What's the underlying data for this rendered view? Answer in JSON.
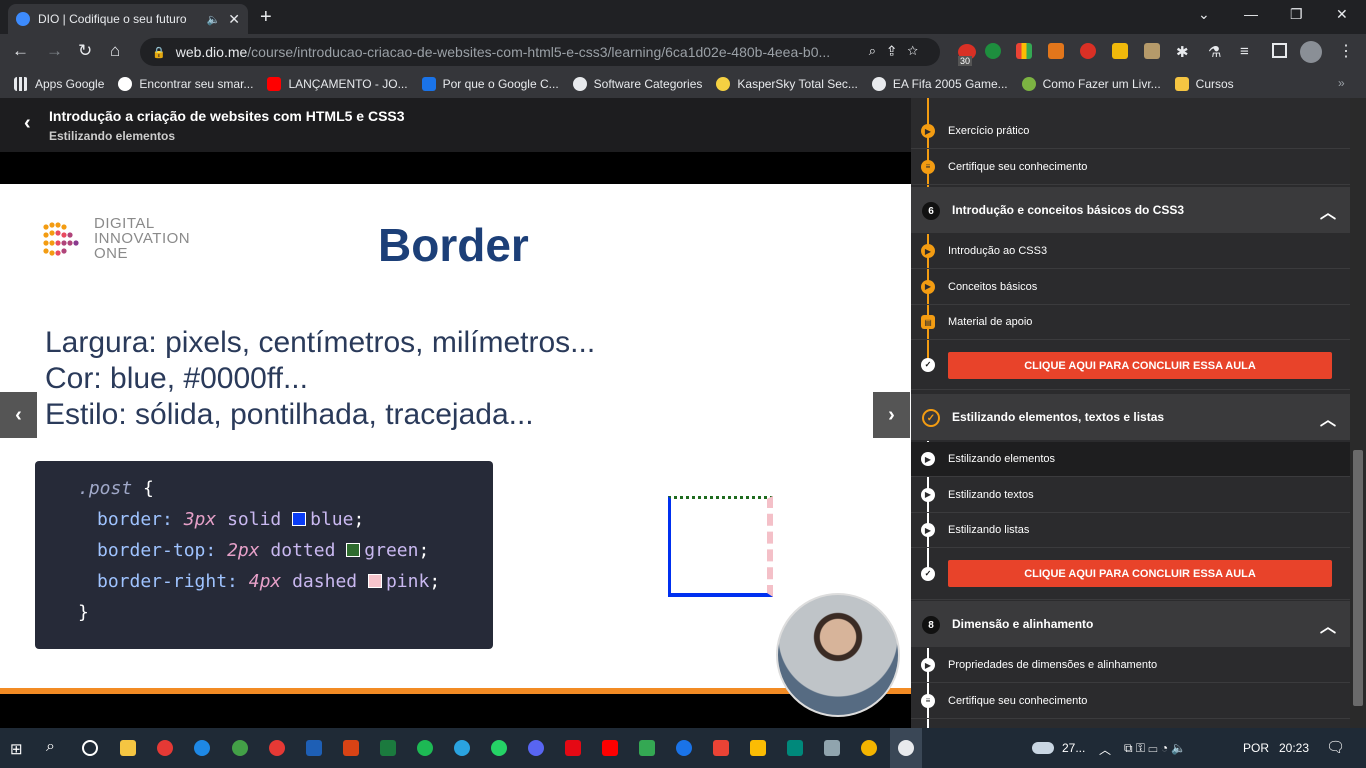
{
  "browser": {
    "tab_title": "DIO | Codifique o seu futuro",
    "url_host": "web.dio.me",
    "url_path": "/course/introducao-criacao-de-websites-com-html5-e-css3/learning/6ca1d02e-480b-4eea-b0...",
    "extension_badge": "30"
  },
  "bookmarks": [
    {
      "label": "Apps Google",
      "color": "#e8eaed"
    },
    {
      "label": "Encontrar seu smar...",
      "color": "#ffffff"
    },
    {
      "label": "LANÇAMENTO - JO...",
      "color": "#ff0000"
    },
    {
      "label": "Por que o Google C...",
      "color": "#1a73e8"
    },
    {
      "label": "Software Categories",
      "color": "#ffffff"
    },
    {
      "label": "KasperSky Total Sec...",
      "color": "#f5d142"
    },
    {
      "label": "EA Fifa 2005 Game...",
      "color": "#ffffff"
    },
    {
      "label": "Como Fazer um Livr...",
      "color": "#7cb342"
    },
    {
      "label": "Cursos",
      "color": "#f5c542"
    }
  ],
  "course": {
    "title": "Introdução a criação de websites com HTML5 e CSS3",
    "subtitle": "Estilizando elementos"
  },
  "slide": {
    "logo_line1": "DIGITAL",
    "logo_line2": "INNOVATION",
    "logo_line3": "ONE",
    "title": "Border",
    "line1": "Largura: pixels, centímetros, milímetros...",
    "line2": "Cor: blue, #0000ff...",
    "line3": "Estilo: sólida, pontilhada, tracejada...",
    "code": {
      "selector": ".post",
      "open": "{",
      "close": "}",
      "decl": [
        {
          "prop": "border",
          "value": "3px",
          "style": "solid",
          "color_name": "blue",
          "swatch": "#0a3cf5"
        },
        {
          "prop": "border-top",
          "value": "2px",
          "style": "dotted",
          "color_name": "green",
          "swatch": "#2e6b2e"
        },
        {
          "prop": "border-right",
          "value": "4px",
          "style": "dashed",
          "color_name": "pink",
          "swatch": "#f6c4cc"
        }
      ]
    }
  },
  "sidebar": {
    "top_items": [
      {
        "label": "Exercício prático",
        "icon": "play-icon"
      },
      {
        "label": "Certifique seu conhecimento",
        "icon": "list-icon"
      }
    ],
    "sections": [
      {
        "num": "6",
        "title": "Introdução e conceitos básicos do CSS3",
        "items": [
          "Introdução ao CSS3",
          "Conceitos básicos",
          "Material de apoio"
        ],
        "button": "CLIQUE AQUI PARA CONCLUIR ESSA AULA"
      },
      {
        "num": "✓",
        "title": "Estilizando elementos, textos e listas",
        "items": [
          "Estilizando elementos",
          "Estilizando textos",
          "Estilizando listas"
        ],
        "button": "CLIQUE AQUI PARA CONCLUIR ESSA AULA"
      },
      {
        "num": "8",
        "title": "Dimensão e alinhamento",
        "items": [
          "Propriedades de dimensões e alinhamento",
          "Certifique seu conhecimento"
        ]
      }
    ]
  },
  "taskbar": {
    "weather": "27...",
    "language": "POR",
    "time": "20:23"
  }
}
